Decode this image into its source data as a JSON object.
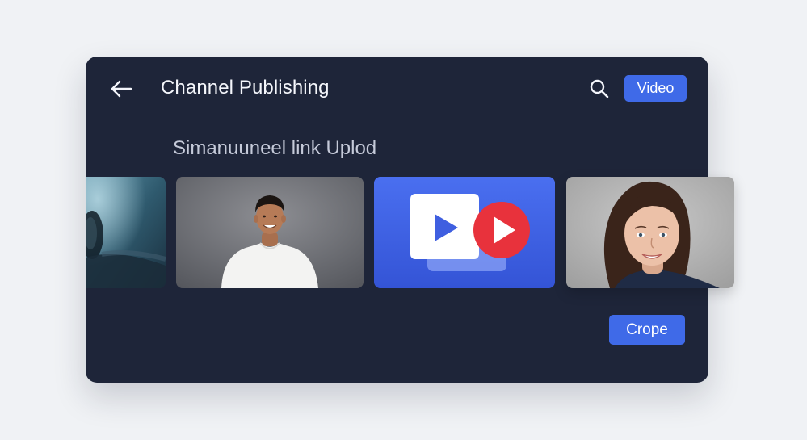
{
  "header": {
    "title": "Channel Publishing",
    "video_button_label": "Video"
  },
  "main": {
    "subtitle": "Simanuuneel link Uplod",
    "thumbnails": [
      {
        "label": "",
        "kind": "partial-photo"
      },
      {
        "label": "",
        "kind": "man-portrait"
      },
      {
        "label": "",
        "kind": "video-play-graphic"
      },
      {
        "label": "",
        "kind": "woman-portrait"
      }
    ]
  },
  "footer": {
    "crope_button_label": "Crope"
  },
  "colors": {
    "card_background": "#1e2539",
    "page_background": "#f0f2f5",
    "accent": "#3f6ae8",
    "play_red": "#e8323c"
  },
  "icons": {
    "back": "arrow-left-icon",
    "search": "search-icon",
    "play": "play-icon"
  }
}
